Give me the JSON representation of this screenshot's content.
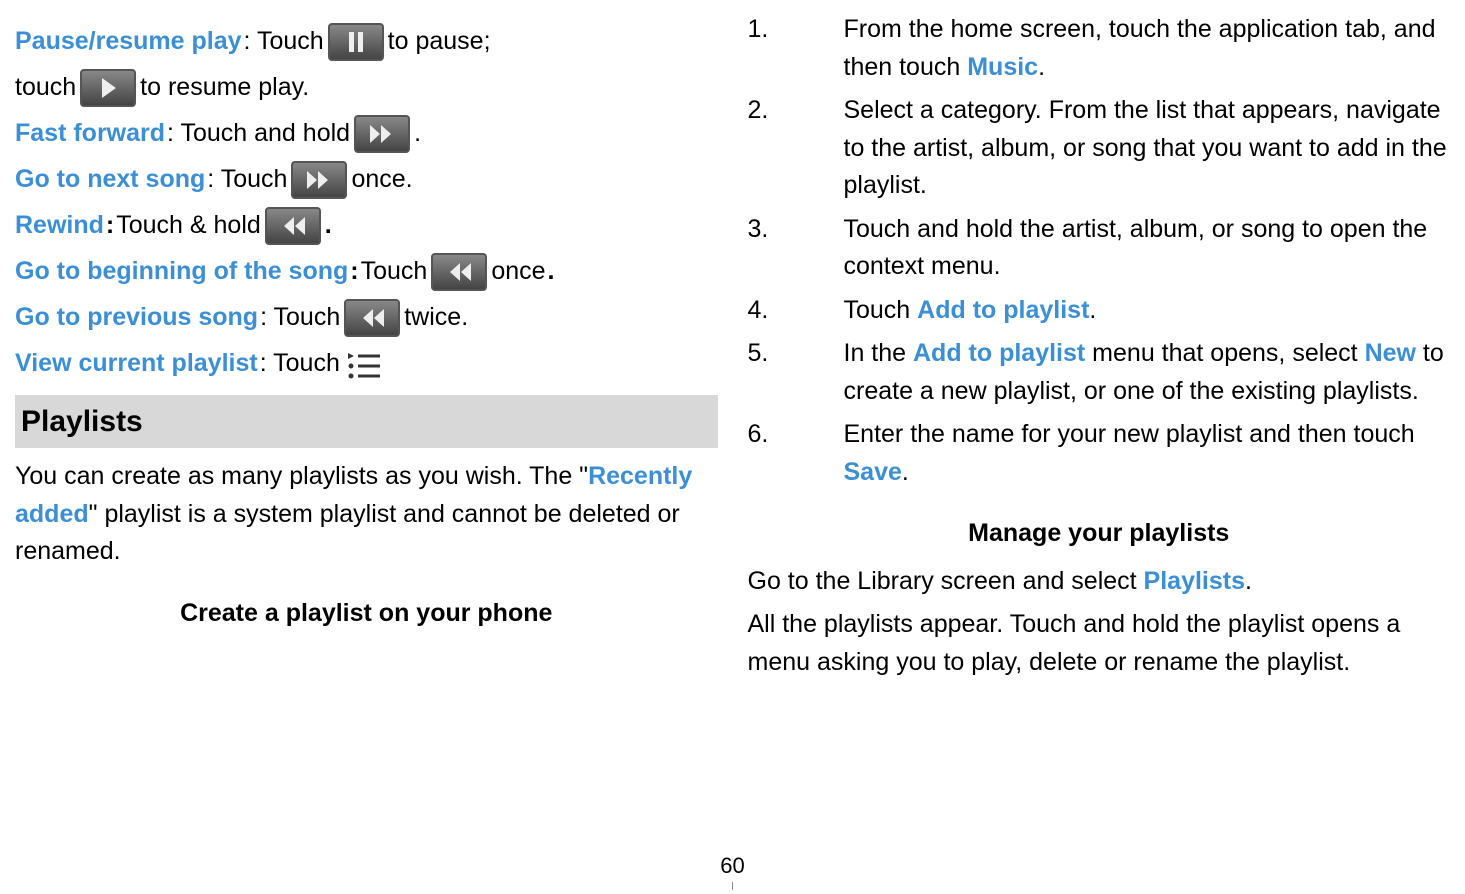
{
  "left": {
    "pause_resume_label": "Pause/resume play",
    "touch_text": ": Touch ",
    "to_pause": "to pause;",
    "touch_lower": "touch",
    "to_resume": "to resume play.",
    "fast_forward_label": "Fast forward",
    "touch_and_hold": ": Touch and hold ",
    "period": ".",
    "next_song_label": "Go to next song",
    "once": "once.",
    "rewind_label": "Rewind",
    "touch_hold_bold": ": ",
    "touch_hold_plain": "Touch & hold",
    "beginning_label": "Go to beginning of the song",
    "colon_touch_bold": ": ",
    "touch_plain_sp": "Touch ",
    "once_bold": "once",
    "previous_label": "Go to previous song",
    "twice": "twice.",
    "view_playlist_label": "View current playlist",
    "playlists_header": "Playlists",
    "playlists_body_1": "You can create as many playlists as you wish. The \"",
    "recently_added": "Recently added",
    "playlists_body_2": "\" playlist is a system playlist and cannot be deleted or renamed.",
    "create_header": "Create a playlist on your phone"
  },
  "right": {
    "steps": [
      {
        "num": "1.",
        "pre": "From the home screen, touch the application tab, and then touch ",
        "link": "Music",
        "post": "."
      },
      {
        "num": "2.",
        "pre": "Select a category. From the list that appears, navigate to the artist, album, or song that you want to add in the playlist.",
        "link": "",
        "post": ""
      },
      {
        "num": "3.",
        "pre": "Touch and hold the artist, album, or song to open the context menu.",
        "link": "",
        "post": ""
      },
      {
        "num": "4.",
        "pre": "Touch ",
        "link": "Add to playlist",
        "post": "."
      },
      {
        "num": "5.",
        "pre": "In the ",
        "link": "Add to playlist",
        "mid": " menu that opens, select ",
        "link2": "New",
        "post": " to create a new playlist, or one of the existing playlists."
      },
      {
        "num": "6.",
        "pre": "Enter the name for your new playlist and then touch ",
        "link": "Save",
        "post": "."
      }
    ],
    "manage_header": "Manage your playlists",
    "manage_body_1": "Go to the Library screen and select ",
    "manage_link": "Playlists",
    "manage_body_1b": ".",
    "manage_body_2": "All the playlists appear. Touch and hold the playlist opens a menu asking you to play, delete or rename the playlist."
  },
  "page_number": "60"
}
